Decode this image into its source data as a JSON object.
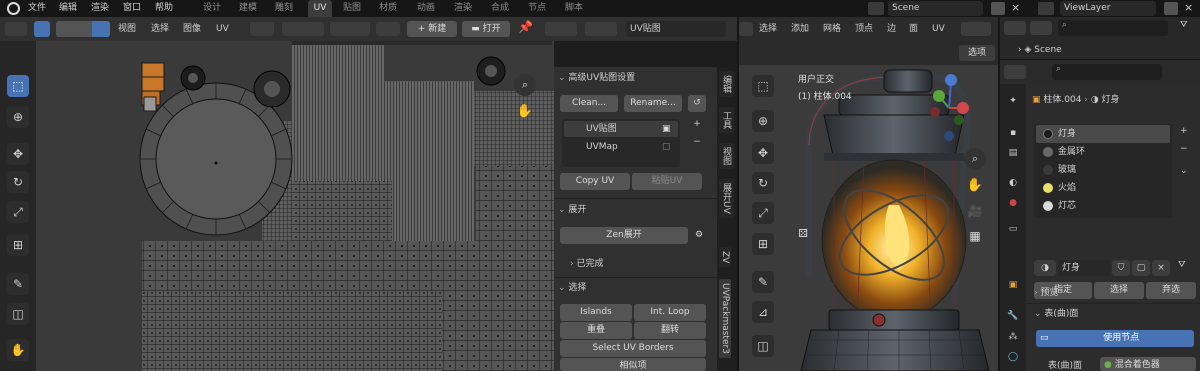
{
  "topbar": {
    "menus": [
      "文件",
      "编辑",
      "渲染",
      "窗口",
      "帮助"
    ],
    "workspaces": [
      "设计",
      "建模",
      "雕刻",
      "UV",
      "贴图",
      "材质",
      "动画",
      "渲染",
      "合成",
      "节点",
      "脚本"
    ],
    "active_workspace": "UV",
    "scene": "Scene",
    "view_layer": "ViewLayer"
  },
  "uv_header": {
    "menus": [
      "视图",
      "选择",
      "图像",
      "UV"
    ],
    "new_label": "新建",
    "open_label": "打开",
    "uvmap_field": "UV贴图"
  },
  "uv_panel": {
    "section_title": "高级UV贴图设置",
    "clean_btn": "Clean...",
    "rename_btn": "Rename...",
    "uv_list": [
      {
        "name": "UV贴图",
        "selected": true
      },
      {
        "name": "UVMap",
        "selected": false
      }
    ],
    "copy_uv": "Copy UV",
    "paste_uv": "粘贴UV",
    "unwrap_title": "展开",
    "zen_unwrap": "Zen展开",
    "finished": "已完成",
    "select_title": "选择",
    "islands": "Islands",
    "int_loop": "Int. Loop",
    "overlap": "重叠",
    "flipped": "翻转",
    "select_uv_borders": "Select UV Borders",
    "similar": "相似项"
  },
  "side_tabs": [
    "编辑",
    "工具",
    "视图",
    "展开UV",
    "ZV",
    "UVPackmaster3"
  ],
  "viewport_header": {
    "menus": [
      "选择",
      "添加",
      "网格",
      "顶点",
      "边",
      "面",
      "UV"
    ],
    "select_mode": "选项"
  },
  "viewport": {
    "view_label": "用户正交",
    "object_label": "(1) 柱体.004"
  },
  "outliner": {
    "search_placeholder": "",
    "scene_item": "Scene"
  },
  "properties": {
    "breadcrumb_object": "柱体.004",
    "breadcrumb_material": "灯身",
    "materials": [
      {
        "name": "灯身",
        "color": "#1a1a1a",
        "selected": true
      },
      {
        "name": "金属环",
        "color": "#6a6a6a",
        "selected": false
      },
      {
        "name": "玻璃",
        "color": "#3a3a3a",
        "selected": false
      },
      {
        "name": "火焰",
        "color": "#e8e26a",
        "selected": false
      },
      {
        "name": "灯芯",
        "color": "#d8d8d8",
        "selected": false
      }
    ],
    "material_field": "灯身",
    "assign": "指定",
    "select": "选择",
    "deselect": "弃选",
    "preview": "预览",
    "surface": "表(曲)面",
    "use_nodes": "使用节点",
    "surface_row": "表(曲)面",
    "mix_shader": "混合着色器"
  }
}
